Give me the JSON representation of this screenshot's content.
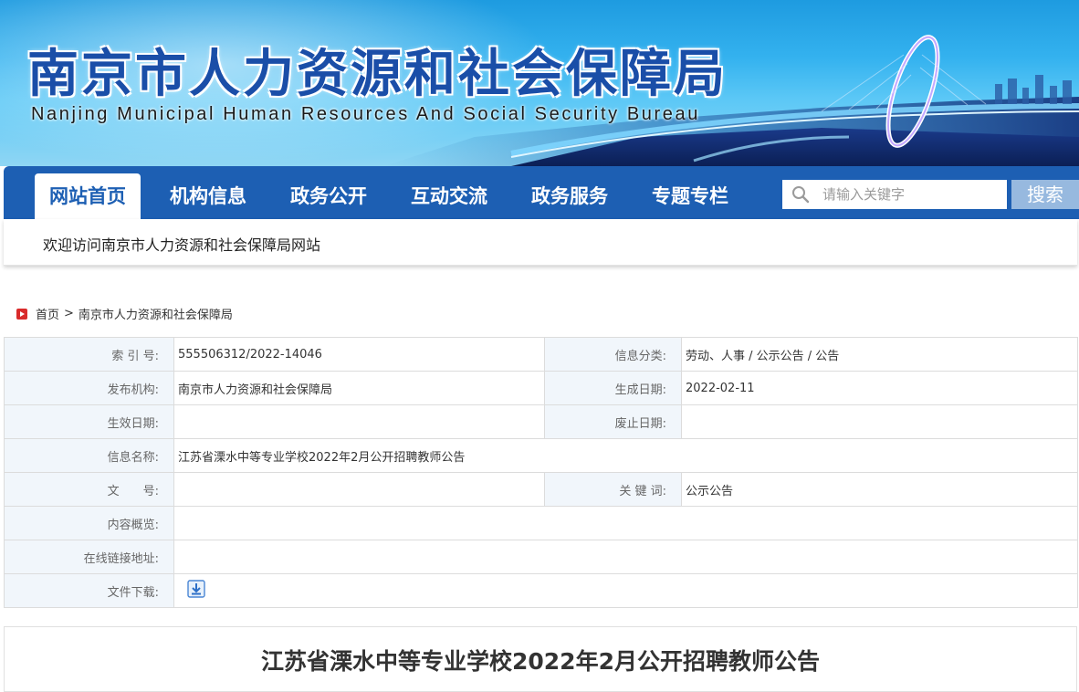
{
  "header": {
    "title_cn": "南京市人力资源和社会保障局",
    "title_en": "Nanjing Municipal Human Resources And Social Security Bureau"
  },
  "nav": {
    "items": [
      {
        "label": "网站首页",
        "active": true
      },
      {
        "label": "机构信息",
        "active": false
      },
      {
        "label": "政务公开",
        "active": false
      },
      {
        "label": "互动交流",
        "active": false
      },
      {
        "label": "政务服务",
        "active": false
      },
      {
        "label": "专题专栏",
        "active": false
      }
    ],
    "search": {
      "placeholder": "请输入关键字",
      "value": "",
      "button_label": "搜索",
      "icon": "search-icon"
    }
  },
  "welcome": {
    "text": "欢迎访问南京市人力资源和社会保障局网站"
  },
  "breadcrumb": {
    "icon": "home-icon",
    "home": "首页",
    "separator": ">",
    "current": "南京市人力资源和社会保障局"
  },
  "meta": {
    "index_no_label": "索 引 号:",
    "index_no": "555506312/2022-14046",
    "category_label": "信息分类:",
    "category": "劳动、人事 / 公示公告 / 公告",
    "publisher_label": "发布机构:",
    "publisher": "南京市人力资源和社会保障局",
    "created_label": "生成日期:",
    "created": "2022-02-11",
    "effective_label": "生效日期:",
    "effective": "",
    "expiry_label": "废止日期:",
    "expiry": "",
    "name_label": "信息名称:",
    "name": "江苏省溧水中等专业学校2022年2月公开招聘教师公告",
    "doc_no_label": "文　　号:",
    "doc_no": "",
    "keywords_label": "关 键 词:",
    "keywords": "公示公告",
    "summary_label": "内容概览:",
    "summary": "",
    "link_label": "在线链接地址:",
    "link": "",
    "download_label": "文件下载:",
    "download_icon": "download-icon"
  },
  "article": {
    "title": "江苏省溧水中等专业学校2022年2月公开招聘教师公告"
  },
  "colors": {
    "nav_blue": "#1d5fb3",
    "label_bg": "#f1f6fb",
    "search_button": "#97b9df",
    "crumb_icon": "#d92b2b"
  }
}
